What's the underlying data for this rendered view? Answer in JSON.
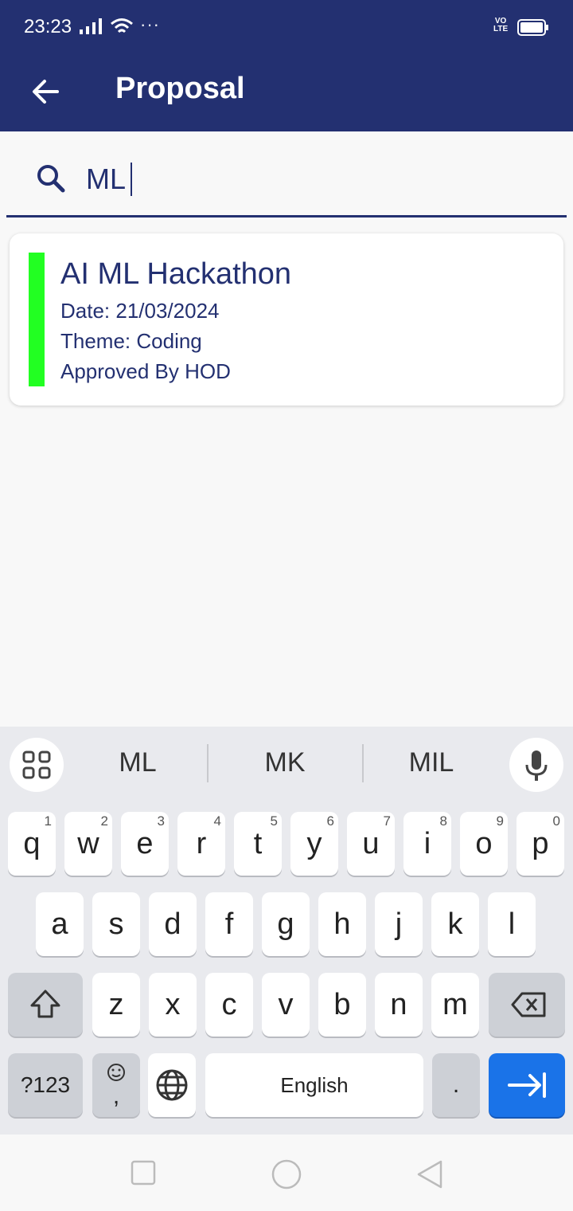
{
  "status": {
    "time": "23:23",
    "volte": "VO LTE"
  },
  "appbar": {
    "title": "Proposal"
  },
  "search": {
    "value": "ML"
  },
  "results": [
    {
      "name": "AI ML Hackathon",
      "date": "Date: 21/03/2024",
      "theme": "Theme: Coding",
      "status": "Approved By HOD",
      "accent": "#22ff22"
    }
  ],
  "keyboard": {
    "suggestions": [
      "ML",
      "MK",
      "MIL"
    ],
    "row1": [
      {
        "k": "q",
        "n": "1"
      },
      {
        "k": "w",
        "n": "2"
      },
      {
        "k": "e",
        "n": "3"
      },
      {
        "k": "r",
        "n": "4"
      },
      {
        "k": "t",
        "n": "5"
      },
      {
        "k": "y",
        "n": "6"
      },
      {
        "k": "u",
        "n": "7"
      },
      {
        "k": "i",
        "n": "8"
      },
      {
        "k": "o",
        "n": "9"
      },
      {
        "k": "p",
        "n": "0"
      }
    ],
    "row2": [
      "a",
      "s",
      "d",
      "f",
      "g",
      "h",
      "j",
      "k",
      "l"
    ],
    "row3": [
      "z",
      "x",
      "c",
      "v",
      "b",
      "n",
      "m"
    ],
    "symbols_label": "?123",
    "comma_label": ",",
    "space_label": "English",
    "period_label": ".",
    "enter_color": "#1a73e8"
  },
  "theme": {
    "primary": "#233071"
  }
}
